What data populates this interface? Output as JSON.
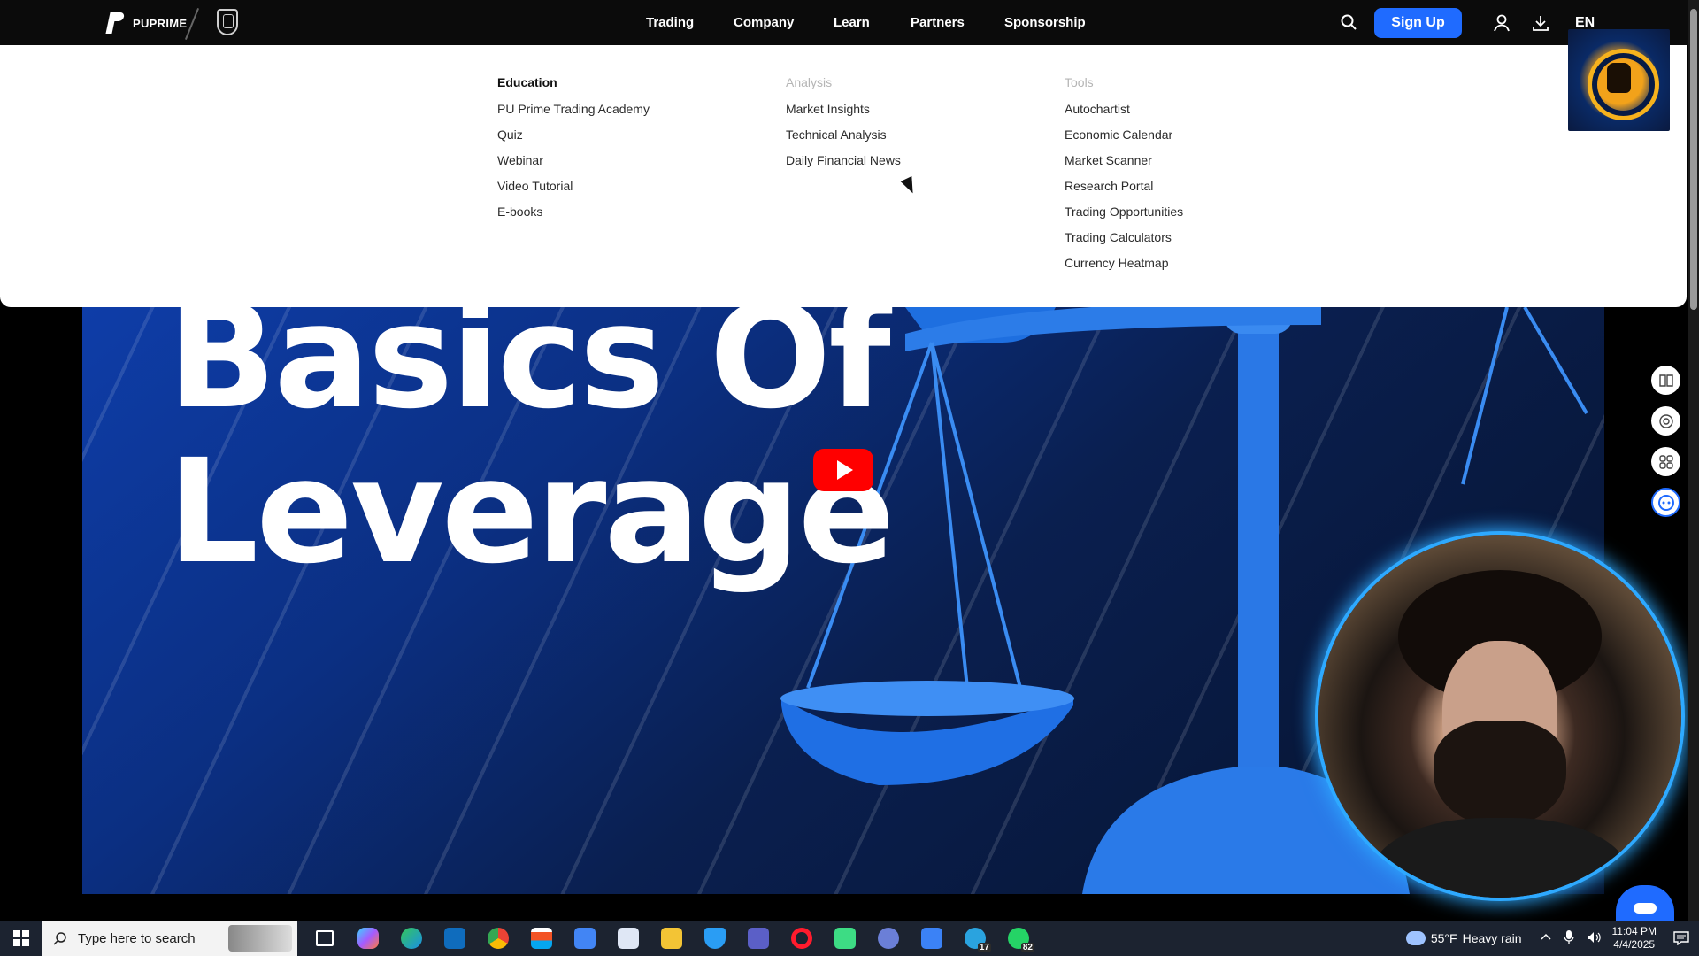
{
  "brand": {
    "name": "PUPRIME"
  },
  "nav": {
    "items": [
      "Trading",
      "Company",
      "Learn",
      "Partners",
      "Sponsorship"
    ],
    "signup_label": "Sign Up",
    "language": "EN"
  },
  "dropdown": {
    "columns": [
      {
        "heading": "Education",
        "items": [
          "PU Prime Trading Academy",
          "Quiz",
          "Webinar",
          "Video Tutorial",
          "E-books"
        ]
      },
      {
        "heading": "Analysis",
        "items": [
          "Market Insights",
          "Technical Analysis",
          "Daily Financial News"
        ]
      },
      {
        "heading": "Tools",
        "items": [
          "Autochartist",
          "Economic Calendar",
          "Market Scanner",
          "Research Portal",
          "Trading Opportunities",
          "Trading Calculators",
          "Currency Heatmap"
        ]
      }
    ]
  },
  "video": {
    "headline_line1": "Basics Of",
    "headline_line2": "Leverage"
  },
  "taskbar": {
    "search_placeholder": "Type here to search",
    "weather_temp": "55°F",
    "weather_desc": "Heavy rain",
    "time": "11:04 PM",
    "date": "4/4/2025",
    "whatsapp_badge": "82",
    "telegram_badge": "17"
  },
  "colors": {
    "accent": "#1f6bff",
    "nav_bg": "#0b0b0b",
    "taskbar_bg": "#1c2330"
  }
}
